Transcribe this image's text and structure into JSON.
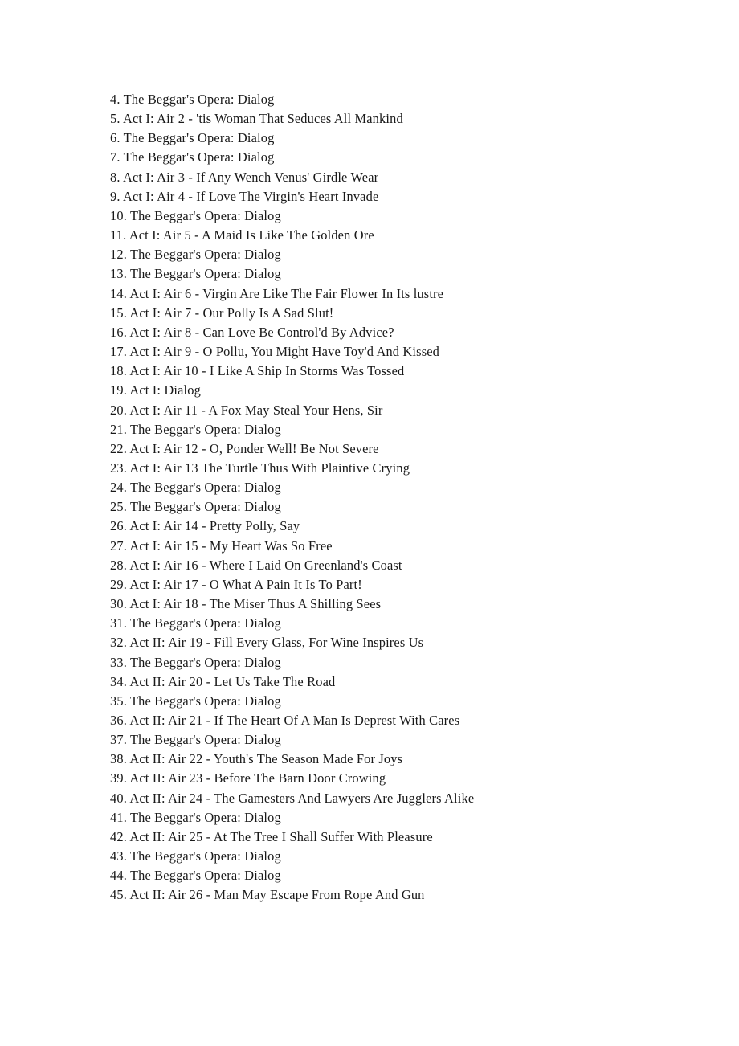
{
  "document": {
    "page_background": "#ffffff",
    "text_color": "#191919",
    "track_list": [
      "4. The Beggar's Opera: Dialog",
      "5. Act I: Air 2 - 'tis Woman That Seduces All Mankind",
      "6. The Beggar's Opera: Dialog",
      "7. The Beggar's Opera: Dialog",
      "8. Act I: Air 3 - If Any Wench Venus' Girdle Wear",
      "9. Act I: Air 4 - If Love The Virgin's Heart Invade",
      "10. The Beggar's Opera: Dialog",
      "11. Act I: Air 5 - A Maid Is Like The Golden Ore",
      "12. The Beggar's Opera: Dialog",
      "13. The Beggar's Opera: Dialog",
      "14. Act I: Air 6 - Virgin Are Like The Fair Flower In Its lustre",
      "15. Act I: Air 7 - Our Polly Is A Sad Slut!",
      "16. Act I: Air 8 - Can Love Be Control'd By Advice?",
      "17. Act I: Air 9 - O Pollu, You Might Have Toy'd And Kissed",
      "18. Act I: Air 10 - I Like A Ship In Storms Was Tossed",
      "19. Act I: Dialog",
      "20. Act I: Air 11 - A Fox May Steal Your Hens, Sir",
      "21. The Beggar's Opera: Dialog",
      "22. Act I: Air 12 - O, Ponder Well! Be Not Severe",
      "23. Act I: Air 13 The Turtle Thus With Plaintive Crying",
      "24. The Beggar's Opera: Dialog",
      "25. The Beggar's Opera: Dialog",
      "26. Act I: Air 14 - Pretty Polly, Say",
      "27. Act I: Air 15 - My Heart Was So Free",
      "28. Act I: Air 16 - Where I Laid On Greenland's Coast",
      "29. Act I: Air 17 - O What A Pain It Is To Part!",
      "30. Act I: Air 18 - The Miser Thus A Shilling Sees",
      "31. The Beggar's Opera: Dialog",
      "32. Act II: Air 19 - Fill Every Glass, For Wine Inspires Us",
      "33. The Beggar's Opera: Dialog",
      "34. Act II: Air 20 - Let Us Take The Road",
      "35. The Beggar's Opera: Dialog",
      "36. Act II: Air 21 - If The Heart Of A Man Is Deprest With Cares",
      "37. The Beggar's Opera: Dialog",
      "38. Act II: Air 22 - Youth's The Season Made For Joys",
      "39. Act II: Air 23 - Before The Barn Door Crowing",
      "40. Act II: Air 24 - The Gamesters And Lawyers Are Jugglers Alike",
      "41. The Beggar's Opera: Dialog",
      "42. Act II: Air 25 - At The Tree I Shall Suffer With Pleasure",
      "43. The Beggar's Opera: Dialog",
      "44. The Beggar's Opera: Dialog",
      "45. Act II: Air 26 - Man May Escape From Rope And Gun"
    ]
  }
}
